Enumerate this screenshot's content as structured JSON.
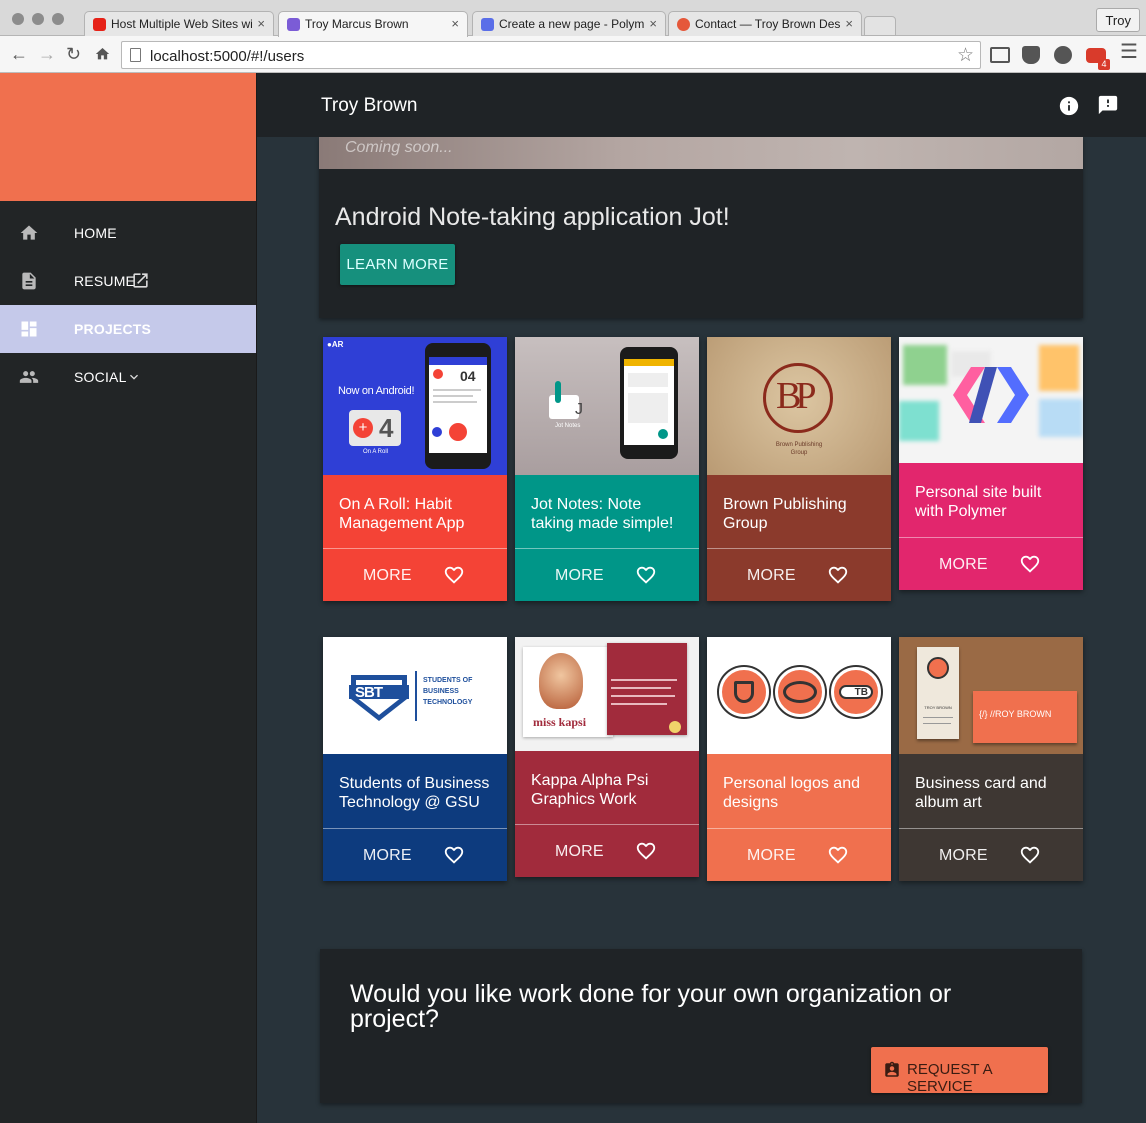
{
  "browser": {
    "tabs": [
      {
        "title": "Host Multiple Web Sites wi",
        "favicon_color": "#e62117"
      },
      {
        "title": "Troy Marcus Brown",
        "favicon_color": "#7b5cd6"
      },
      {
        "title": "Create a new page - Polym",
        "favicon_color": "#5a6ee8"
      },
      {
        "title": "Contact — Troy Brown Des",
        "favicon_color": "#e5583a"
      }
    ],
    "profile": "Troy",
    "url": "localhost:5000/#!/users",
    "gmail_badge": "4"
  },
  "sidebar": {
    "items": [
      {
        "label": "HOME",
        "icon": "home-icon"
      },
      {
        "label": "RESUME",
        "icon": "document-icon"
      },
      {
        "label": "PROJECTS",
        "icon": "dashboard-icon"
      },
      {
        "label": "SOCIAL",
        "icon": "people-icon"
      }
    ]
  },
  "header": {
    "title": "Troy Brown"
  },
  "hero": {
    "image_text": "Coming soon...",
    "title": "Android Note-taking application Jot!",
    "button": "LEARN MORE"
  },
  "cards": [
    {
      "caption": "On A Roll: Habit Management App",
      "more": "MORE",
      "color": "#f44336",
      "thumb_text": "Now on Android!",
      "thumb_sub": "On A Roll",
      "thumb_num": "04"
    },
    {
      "caption": "Jot Notes: Note taking made simple!",
      "more": "MORE",
      "color": "#009688",
      "thumb_text": "Jot Notes"
    },
    {
      "caption": "Brown Publishing Group",
      "more": "MORE",
      "color": "#8b3a2c",
      "thumb_text": "Brown Publishing Group",
      "thumb_logo": "BP"
    },
    {
      "caption": "Personal site built with Polymer",
      "more": "MORE",
      "color": "#e2266d"
    },
    {
      "caption": "Students of Business Technology @ GSU",
      "more": "MORE",
      "color": "#0d3b7e",
      "thumb_logo": "SBT",
      "thumb_text": "STUDENTS OF BUSINESS TECHNOLOGY"
    },
    {
      "caption": "Kappa Alpha Psi Graphics Work",
      "more": "MORE",
      "color": "#a12b3c",
      "thumb_text": "miss kapsi"
    },
    {
      "caption": "Personal logos and designs",
      "more": "MORE",
      "color": "#f0704e",
      "thumb_logo": "TB"
    },
    {
      "caption": "Business card and album art",
      "more": "MORE",
      "color": "#3e3733",
      "thumb_text": "TROY BROWN",
      "thumb_sub": "{/} //ROY BROWN"
    }
  ],
  "cta": {
    "text": "Would you like work done for your own organization or project?",
    "button": "REQUEST A SERVICE"
  }
}
